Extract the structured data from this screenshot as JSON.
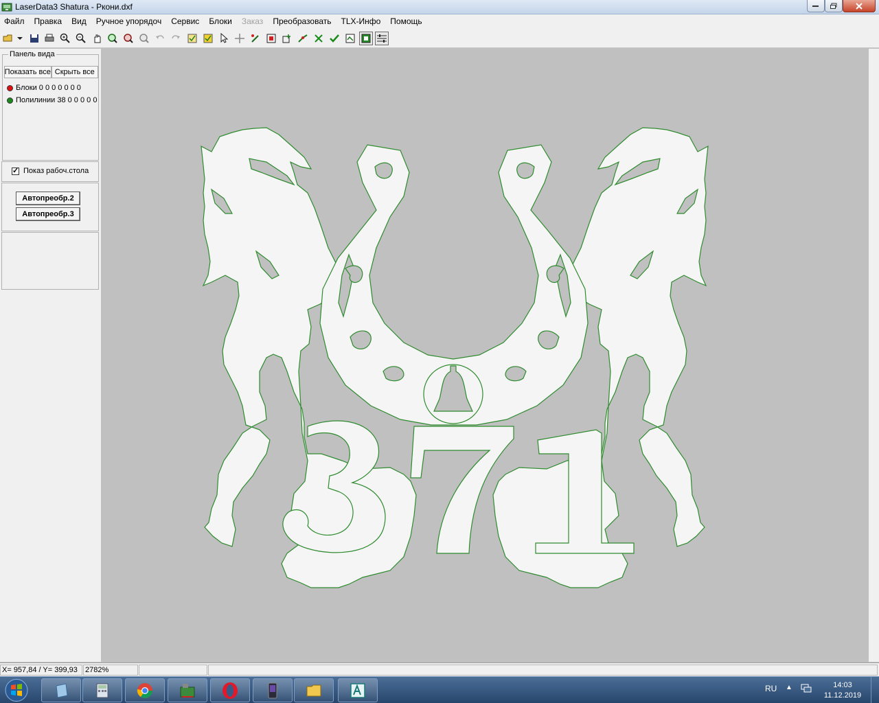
{
  "window": {
    "title": "LaserData3 Shatura - Ркони.dxf"
  },
  "menu": [
    {
      "label": "Файл",
      "enabled": true
    },
    {
      "label": "Правка",
      "enabled": true
    },
    {
      "label": "Вид",
      "enabled": true
    },
    {
      "label": "Ручное упорядоч",
      "enabled": true
    },
    {
      "label": "Сервис",
      "enabled": true
    },
    {
      "label": "Блоки",
      "enabled": true
    },
    {
      "label": "Заказ",
      "enabled": false
    },
    {
      "label": "Преобразовать",
      "enabled": true
    },
    {
      "label": "TLX-Инфо",
      "enabled": true
    },
    {
      "label": "Помощь",
      "enabled": true
    }
  ],
  "toolbar": {
    "icons": [
      "open-folder-icon",
      "save-icon",
      "print-icon",
      "zoom-in-icon",
      "zoom-out-icon",
      "pan-hand-icon",
      "zoom-window-icon",
      "zoom-all-icon",
      "zoom-previous-icon",
      "undo-icon",
      "redo-icon",
      "check-list-icon",
      "check-list-yellow-icon",
      "select-arrow-icon",
      "move-cross-icon",
      "edit-node-icon",
      "frame-icon",
      "add-node-icon",
      "connect-icon",
      "cut-icon",
      "check-icon",
      "optimize-icon",
      "run-icon",
      "settings-icon"
    ]
  },
  "view_panel": {
    "legend": "Панель вида",
    "show_all": "Показать все",
    "hide_all": "Скрыть все",
    "layers": [
      {
        "label": "Блоки 0 0 0 0 0 0 0",
        "color": "#e01010"
      },
      {
        "label": "Полилинии 38 0 0 0 0 0 0",
        "color": "#1a8a1a"
      }
    ],
    "show_desktop_label": "Показ рабоч.стола",
    "show_desktop_checked": true,
    "auto_buttons": [
      "Автопреобр.2",
      "Автопреобр.3"
    ]
  },
  "drawing": {
    "number_text": "371",
    "outline_color": "#2e8b2e",
    "fill_color": "#f5f5f5",
    "background_color": "#c0c0c0"
  },
  "statusbar": {
    "coords": "X= 957,84 / Y= 399,93",
    "zoom": "2782%"
  },
  "taskbar": {
    "apps": [
      "windows-explorer-icon",
      "calculator-icon",
      "chrome-icon",
      "laserdata-icon",
      "opera-icon",
      "media-icon",
      "folder-icon",
      "autocad-icon"
    ],
    "language": "RU",
    "time": "14:03",
    "date": "11.12.2019"
  }
}
